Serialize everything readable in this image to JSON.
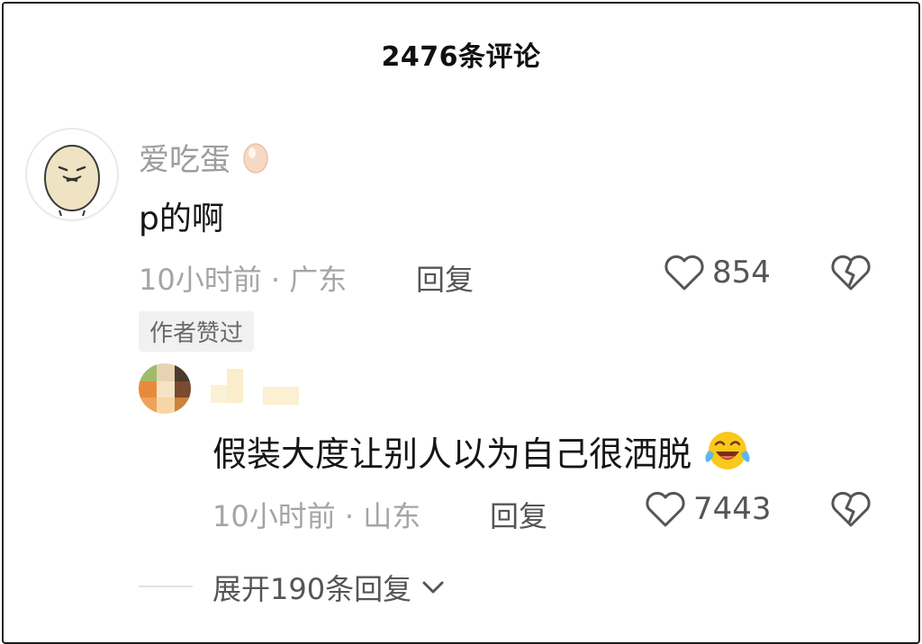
{
  "header": {
    "title": "2476条评论"
  },
  "comment": {
    "username": "爱吃蛋",
    "username_icon": "egg-emoji",
    "text": "p的啊",
    "time_location": "10小时前 · 广东",
    "reply_label": "回复",
    "likes": "854",
    "author_badge": "作者赞过"
  },
  "reply": {
    "text": "假装大度让别人以为自己很洒脱",
    "text_emoji": "laughing-crying-emoji",
    "time_location": "10小时前 · 山东",
    "reply_label": "回复",
    "likes": "7443"
  },
  "expand": {
    "label": "展开190条回复"
  },
  "colors": {
    "text_primary": "#161616",
    "text_secondary": "#a5a5a5",
    "badge_bg": "#f1f1f1"
  }
}
